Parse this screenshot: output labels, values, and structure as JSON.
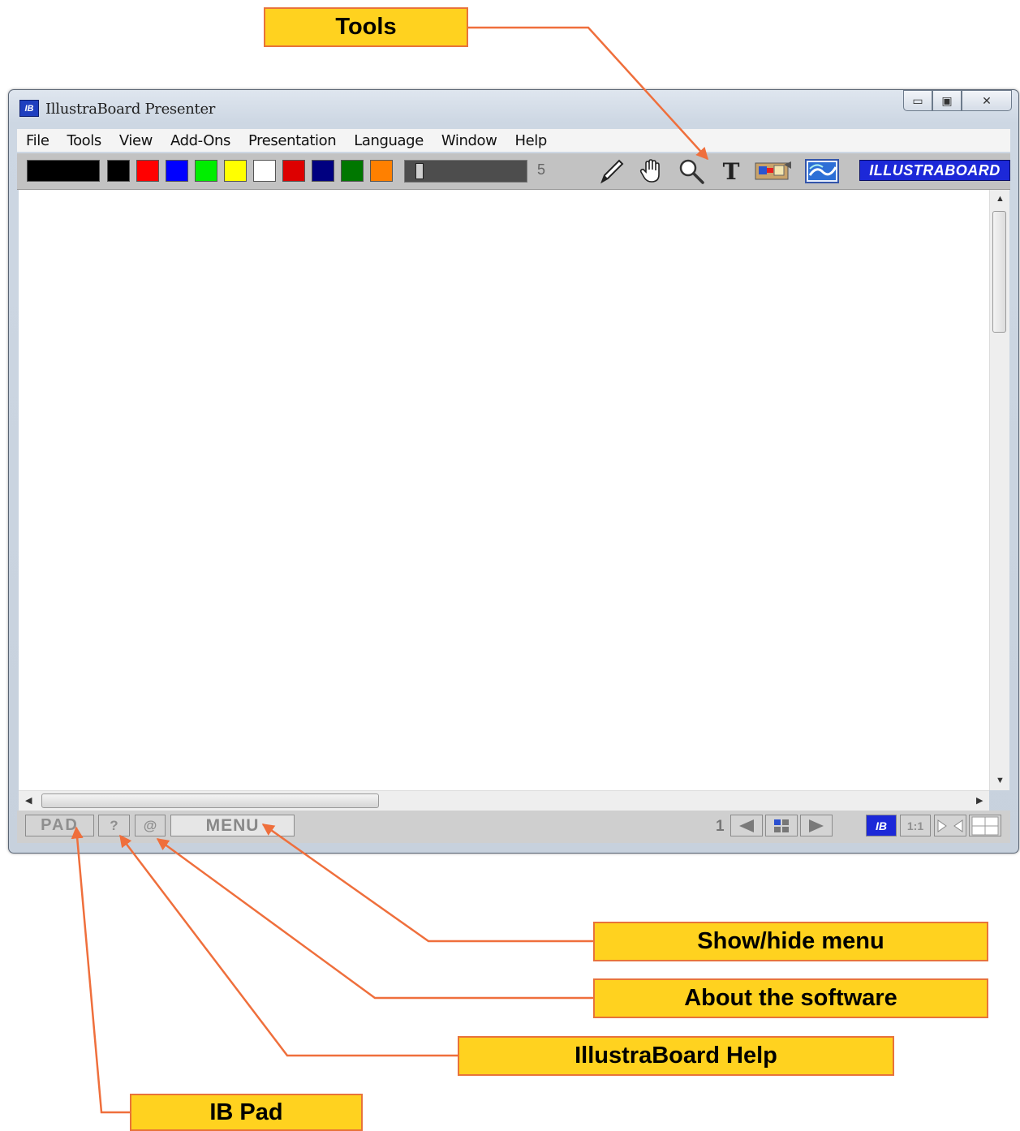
{
  "window": {
    "title": "IllustraBoard Presenter",
    "app_icon_text": "IB",
    "caption_buttons": {
      "minimize": "▭",
      "maximize": "▣",
      "close": "✕"
    }
  },
  "menubar": {
    "items": [
      "File",
      "Tools",
      "View",
      "Add-Ons",
      "Presentation",
      "Language",
      "Window",
      "Help"
    ]
  },
  "toolbar": {
    "colors": [
      "#000000",
      "#000000",
      "#ff0000",
      "#0000ff",
      "#00ee00",
      "#ffff00",
      "#ffffff",
      "#dd0000",
      "#000080",
      "#007700",
      "#ff8000"
    ],
    "pen_thickness": "5",
    "tools": [
      "pencil-icon",
      "hand-icon",
      "magnifier-icon",
      "text-icon",
      "screen-capture-icon",
      "background-icon"
    ],
    "text_tool_glyph": "T",
    "brand": "ILLUSTRABOARD"
  },
  "statusbar": {
    "pad_label": "PAD",
    "help_label": "?",
    "about_label": "@",
    "menu_label": "MENU",
    "page_number": "1",
    "ib_label": "IB",
    "zoom_label": "1:1"
  },
  "callouts": {
    "tools": "Tools",
    "show_hide_menu": "Show/hide menu",
    "about": "About the software",
    "help": "IllustraBoard Help",
    "ib_pad": "IB Pad"
  },
  "colors": {
    "callout_fill": "#ffd21f",
    "callout_border": "#e8733a"
  }
}
